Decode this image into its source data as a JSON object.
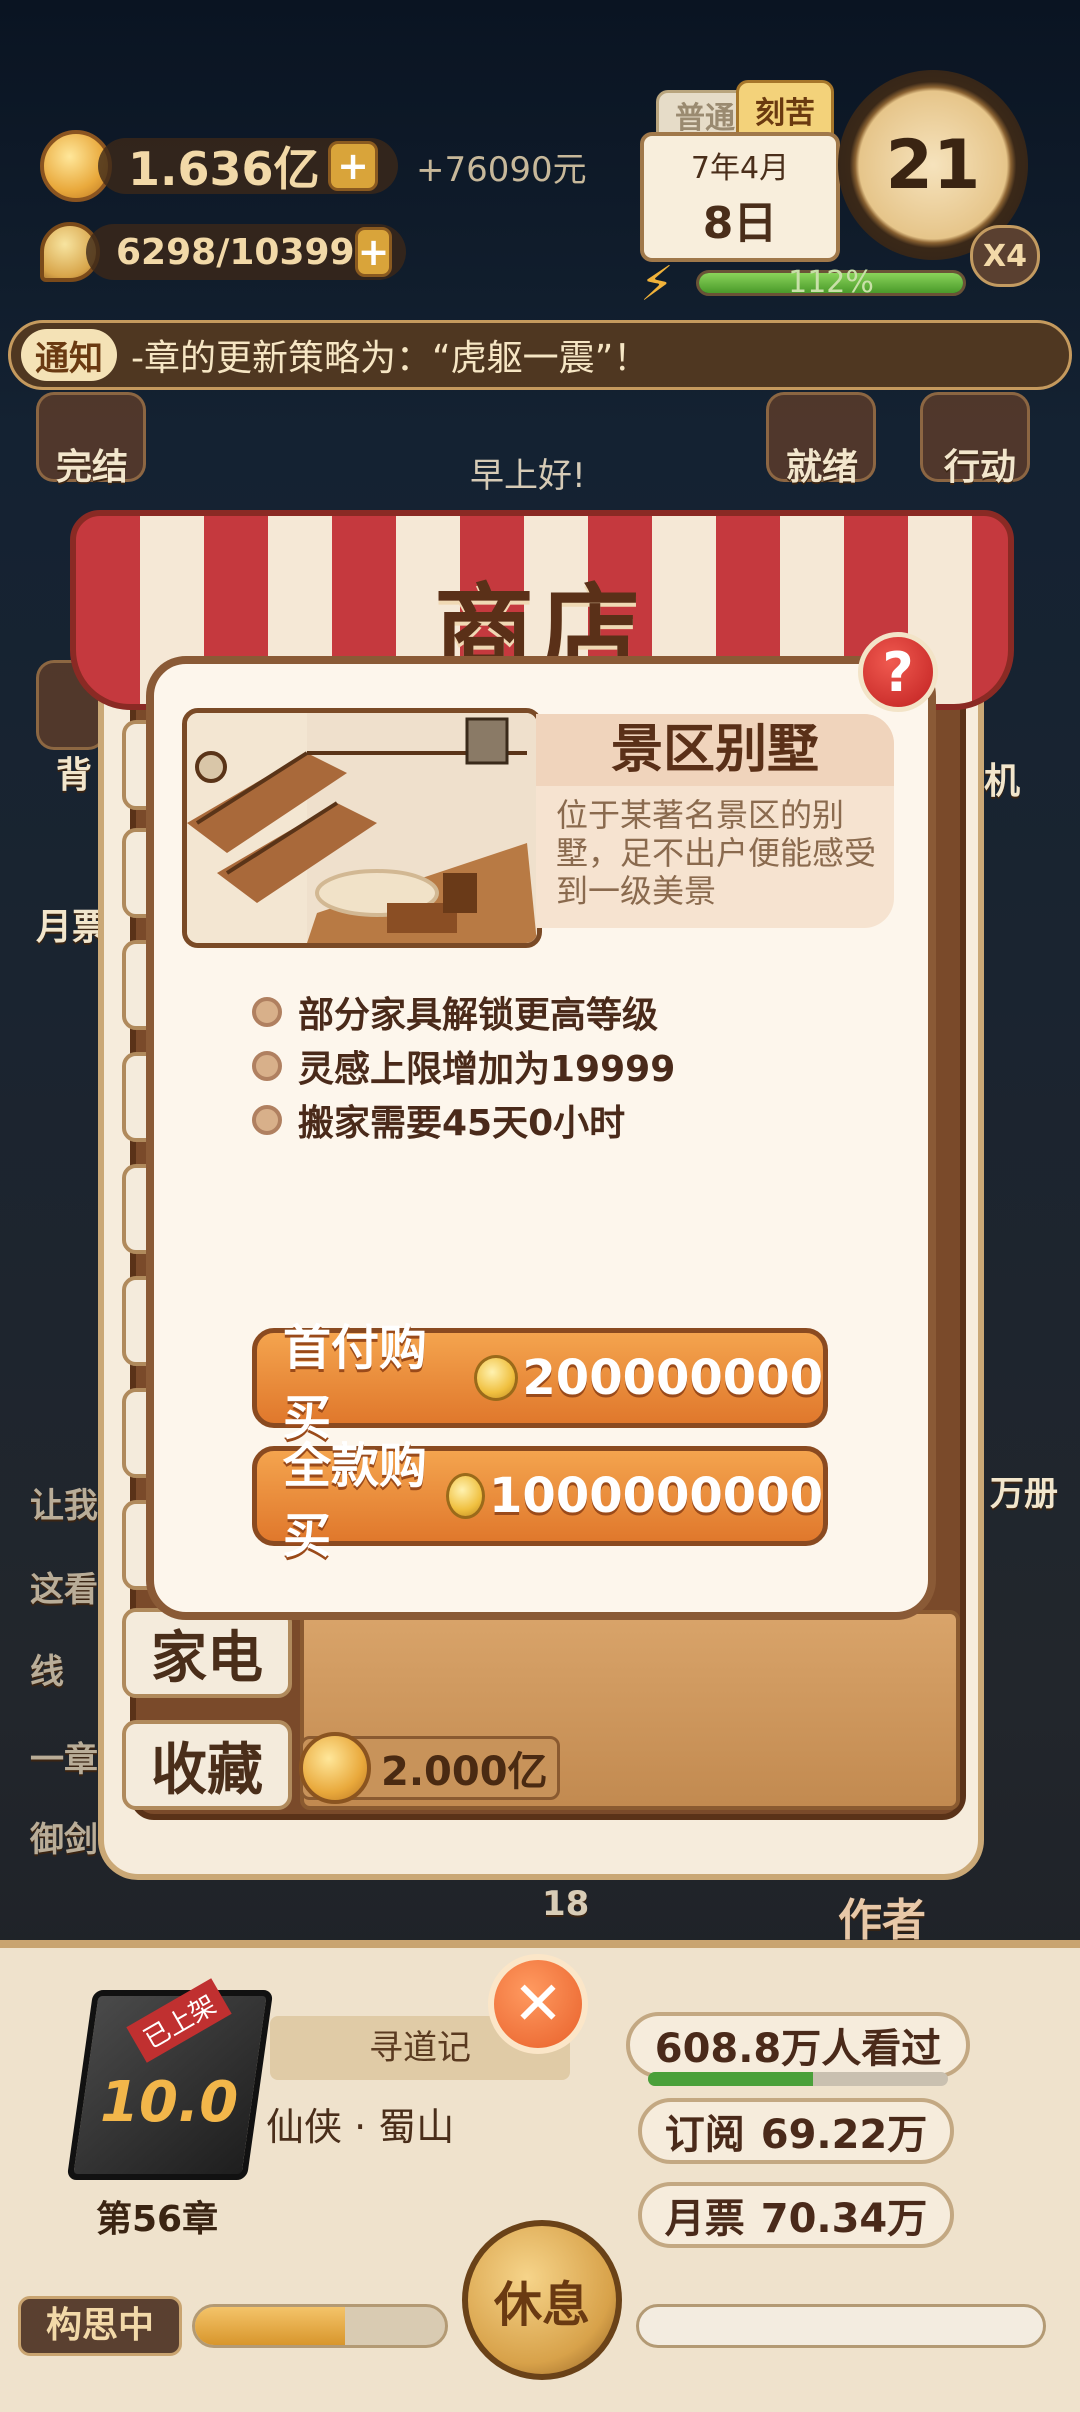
{
  "hud": {
    "coins": "1.636亿",
    "income": "+76090元",
    "inspiration": "6298/10399",
    "plus_glyph": "+"
  },
  "calendar": {
    "mode_normal": "普通",
    "mode_hard": "刻苦",
    "year_month": "7年4月",
    "day": "8日",
    "clock_value": "21",
    "speed": "X4",
    "energy_label": "112%",
    "energy_level": 1.0
  },
  "notice": {
    "tag": "通知",
    "text": "-章的更新策略为：“虎躯一震”！"
  },
  "background": {
    "greeting": "早上好!",
    "left_labels": [
      "完结",
      "背",
      "月票"
    ],
    "right_labels": [
      "就绪",
      "行动",
      "机"
    ],
    "right_side_text": "万册",
    "left_side_text": [
      "让我",
      "这看",
      "线",
      "一章",
      "御剑"
    ],
    "behind_numbers": [
      "18"
    ],
    "behind_text": "作者"
  },
  "shop": {
    "title": "商店",
    "tabs": [
      "家电",
      "收藏"
    ],
    "price_chip": "2.000亿"
  },
  "modal": {
    "help": "?",
    "item_name": "景区别墅",
    "item_desc": "位于某著名景区的别墅，足不出户便能感受到一级美景",
    "features": [
      "部分家具解锁更高等级",
      "灵感上限增加为19999",
      "搬家需要45天0小时"
    ],
    "buy_down": {
      "label": "首付购买",
      "amount": "200000000"
    },
    "buy_full": {
      "label": "全款购买",
      "amount": "1000000000"
    }
  },
  "bottom": {
    "book_tag": "已上架",
    "score": "10.0",
    "chapter": "第56章",
    "book_name": "寻道记",
    "genre": "仙侠 · 蜀山",
    "views": "608.8万人看过",
    "views_level": 0.55,
    "subscriptions_label": "订阅",
    "subscriptions_value": "69.22万",
    "tickets_label": "月票",
    "tickets_value": "70.34万",
    "rest": "休息",
    "close": "✕",
    "thinking": "构思中",
    "thinking_level": 0.6
  },
  "colors": {
    "accent_orange": "#e0782c",
    "awning_red": "#c5393e",
    "help_red": "#c02020",
    "energy_green": "#4a9a2a"
  }
}
